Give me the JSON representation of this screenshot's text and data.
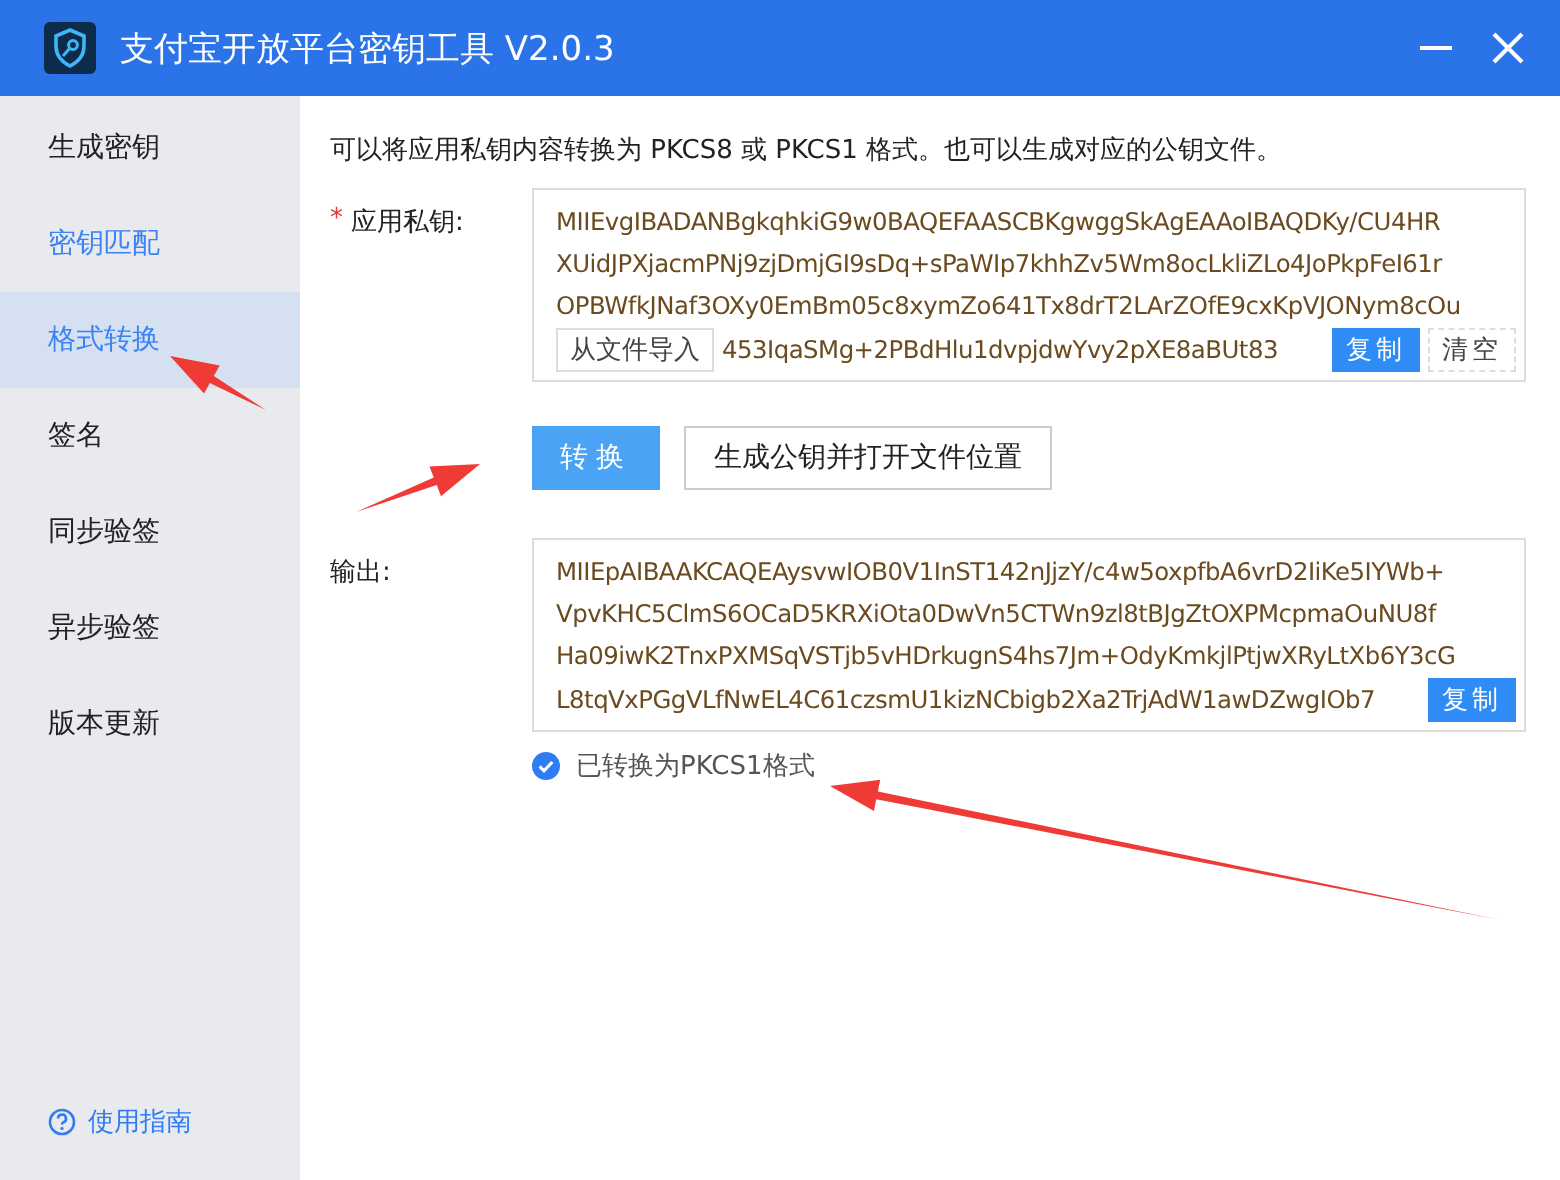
{
  "window": {
    "title": "支付宝开放平台密钥工具 V2.0.3"
  },
  "sidebar": {
    "items": [
      {
        "label": "生成密钥",
        "selected": false,
        "hover": false
      },
      {
        "label": "密钥匹配",
        "selected": false,
        "hover": true
      },
      {
        "label": "格式转换",
        "selected": true,
        "hover": false
      },
      {
        "label": "签名",
        "selected": false,
        "hover": false
      },
      {
        "label": "同步验签",
        "selected": false,
        "hover": false
      },
      {
        "label": "异步验签",
        "selected": false,
        "hover": false
      },
      {
        "label": "版本更新",
        "selected": false,
        "hover": false
      }
    ],
    "help": "使用指南"
  },
  "description": "可以将应用私钥内容转换为 PKCS8 或 PKCS1 格式。也可以生成对应的公钥文件。",
  "private_key": {
    "required_mark": "*",
    "label": "应用私钥:",
    "lines": [
      "MIIEvgIBADANBgkqhkiG9w0BAQEFAASCBKgwggSkAgEAAoIBAQDKy/CU4HR",
      "XUidJPXjacmPNj9zjDmjGI9sDq+sPaWIp7khhZv5Wm8ocLkliZLo4JoPkpFeI61r",
      "OPBWfkJNaf3OXy0EmBm05c8xymZo641Tx8drT2LArZOfE9cxKpVJONym8cOu",
      "453IqaSMg+2PBdHlu1dvpjdwYvy2pXE8aBUt83"
    ],
    "import_button": "从文件导入",
    "copy_button": "复制",
    "clear_button": "清空"
  },
  "actions": [
    {
      "label": "转换",
      "kind": "primary"
    },
    {
      "label": "生成公钥并打开文件位置",
      "kind": "default"
    }
  ],
  "output": {
    "label": "输出:",
    "lines": [
      "MIIEpAIBAAKCAQEAysvwIOB0V1InST142nJjzY/c4w5oxpfbA6vrD2IiKe5IYWb+",
      "VpvKHC5ClmS6OCaD5KRXiOta0DwVn5CTWn9zl8tBJgZtOXPMcpmaOuNU8f",
      "Ha09iwK2TnxPXMSqVSTjb5vHDrkugnS4hs7Jm+OdyKmkjlPtjwXRyLtXb6Y3cG",
      "L8tqVxPGgVLfNwEL4C61czsmU1kizNCbigb2Xa2TrjAdW1awDZwgIOb7"
    ],
    "copy_button": "复制"
  },
  "status": {
    "label": "已转换为PKCS1格式",
    "checked": true
  },
  "annotation_arrows": [
    {
      "kind": "arrow"
    },
    {
      "kind": "arrow"
    },
    {
      "kind": "arrow"
    }
  ]
}
